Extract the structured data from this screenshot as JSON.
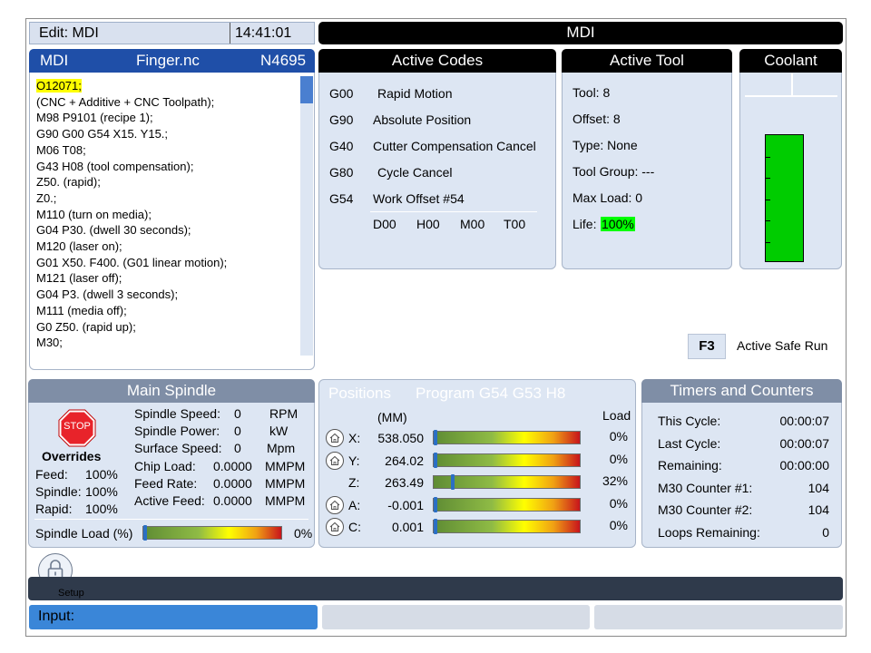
{
  "header": {
    "mode_label": "Edit: MDI",
    "clock": "14:41:01",
    "title": "MDI"
  },
  "program": {
    "mode": "MDI",
    "file": "Finger.nc",
    "line_no": "N4695",
    "lines": [
      "O12071;",
      "(CNC + Additive + CNC Toolpath);",
      "M98  P9101 (recipe 1);",
      "G90 G00 G54 X15. Y15.;",
      "M06  T08;",
      "G43  H08 (tool compensation);",
      "Z50. (rapid);",
      "Z0.;",
      "M110 (turn on media);",
      "G04 P30. (dwell 30 seconds);",
      "M120 (laser on);",
      "G01 X50. F400. (G01 linear motion);",
      "M121 (laser off);",
      "G04 P3. (dwell 3 seconds);",
      "M111 (media off);",
      "G0 Z50. (rapid up);",
      "M30;"
    ]
  },
  "active_codes": {
    "title": "Active Codes",
    "codes": [
      {
        "code": "G00",
        "desc": "Rapid Motion"
      },
      {
        "code": "G90",
        "desc": "Absolute Position"
      },
      {
        "code": "G40",
        "desc": "Cutter Compensation Cancel"
      },
      {
        "code": "G80",
        "desc": "Cycle Cancel"
      },
      {
        "code": "G54",
        "desc": "Work Offset #54"
      }
    ],
    "dhmt": [
      "D00",
      "H00",
      "M00",
      "T00"
    ]
  },
  "active_tool": {
    "title": "Active Tool",
    "tool": "Tool: 8",
    "offset": "Offset: 8",
    "type": "Type: None",
    "group": "Tool Group: ---",
    "max_load": "Max Load: 0",
    "life_label": "Life:",
    "life_value": "100%"
  },
  "coolant": {
    "title": "Coolant",
    "level": 1.0
  },
  "safe_run": {
    "key": "F3",
    "label": "Active Safe Run"
  },
  "spindle": {
    "title": "Main Spindle",
    "stop_label": "STOP",
    "overrides_title": "Overrides",
    "overrides": [
      {
        "label": "Feed:",
        "value": "100%"
      },
      {
        "label": "Spindle:",
        "value": "100%"
      },
      {
        "label": "Rapid:",
        "value": "100%"
      }
    ],
    "stats": [
      {
        "label": "Spindle Speed:",
        "value": "0",
        "unit": "RPM"
      },
      {
        "label": "Spindle Power:",
        "value": "0",
        "unit": "kW"
      },
      {
        "label": "Surface Speed:",
        "value": "0",
        "unit": "Mpm"
      },
      {
        "label": "Chip Load:",
        "value": "0.0000",
        "unit": "MMPM"
      },
      {
        "label": "Feed Rate:",
        "value": "0.0000",
        "unit": "MMPM"
      },
      {
        "label": "Active Feed:",
        "value": "0.0000",
        "unit": "MMPM"
      }
    ],
    "load_label": "Spindle Load (%)",
    "load_value": "0%",
    "load_fraction": 0
  },
  "positions": {
    "title": "Positions",
    "program": "Program G54 G53 H8",
    "unit": "(MM)",
    "load_header": "Load",
    "axes": [
      {
        "axis": "X:",
        "value": "538.050",
        "load": "0%",
        "fraction": 0.0,
        "home": true
      },
      {
        "axis": "Y:",
        "value": "264.02",
        "load": "0%",
        "fraction": 0.0,
        "home": true
      },
      {
        "axis": "Z:",
        "value": "263.49",
        "load": "32%",
        "fraction": 0.32,
        "home": false
      },
      {
        "axis": "A:",
        "value": "-0.001",
        "load": "0%",
        "fraction": 0.0,
        "home": true
      },
      {
        "axis": "C:",
        "value": "0.001",
        "load": "0%",
        "fraction": 0.0,
        "home": true
      }
    ]
  },
  "timers": {
    "title": "Timers and Counters",
    "rows": [
      {
        "label": "This Cycle:",
        "value": "00:00:07"
      },
      {
        "label": "Last Cycle:",
        "value": "00:00:07"
      },
      {
        "label": "Remaining:",
        "value": "00:00:00"
      },
      {
        "label": "M30 Counter #1:",
        "value": "104"
      },
      {
        "label": "M30 Counter #2:",
        "value": "104"
      },
      {
        "label": "Loops Remaining:",
        "value": "0"
      }
    ]
  },
  "footer": {
    "setup_label": "Setup",
    "input_label": "Input:"
  },
  "colors": {
    "accent_blue": "#1f4fa8",
    "input_blue": "#3a86d8",
    "life_green": "#00ff00",
    "highlight_yellow": "#ffff00",
    "coolant_green": "#00cc00"
  }
}
